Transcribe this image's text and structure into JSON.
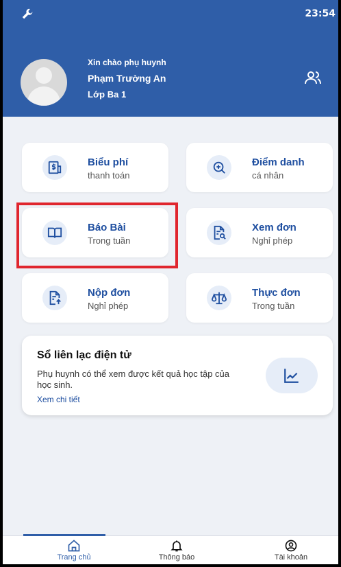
{
  "status_bar": {
    "time": "23:54"
  },
  "header": {
    "greeting": "Xin chào phụ huynh",
    "student_name": "Phạm Trường An",
    "class_name": "Lớp Ba 1"
  },
  "menu": [
    {
      "title": "Biểu phí",
      "subtitle": "thanh toán",
      "icon": "invoice-dollar-icon"
    },
    {
      "title": "Điểm danh",
      "subtitle": "cá nhân",
      "icon": "zoom-plus-icon"
    },
    {
      "title": "Báo Bài",
      "subtitle": "Trong tuần",
      "icon": "open-book-icon"
    },
    {
      "title": "Xem đơn",
      "subtitle": "Nghỉ phép",
      "icon": "document-search-icon"
    },
    {
      "title": "Nộp đơn",
      "subtitle": "Nghỉ phép",
      "icon": "document-upload-icon"
    },
    {
      "title": "Thực đơn",
      "subtitle": "Trong tuần",
      "icon": "scale-icon"
    }
  ],
  "lien_lac": {
    "title": "Sổ liên lạc điện tử",
    "description": "Phụ huynh có thể xem được kết quả học tập của học sinh.",
    "link": "Xem chi tiết"
  },
  "nav": [
    {
      "label": "Trang chủ",
      "icon": "home-icon",
      "active": true
    },
    {
      "label": "Thông báo",
      "icon": "bell-icon",
      "active": false
    },
    {
      "label": "Tài khoản",
      "icon": "account-icon",
      "active": false
    }
  ],
  "colors": {
    "primary": "#2f5ea8",
    "highlight": "#e0262e",
    "background": "#eef1f6"
  }
}
